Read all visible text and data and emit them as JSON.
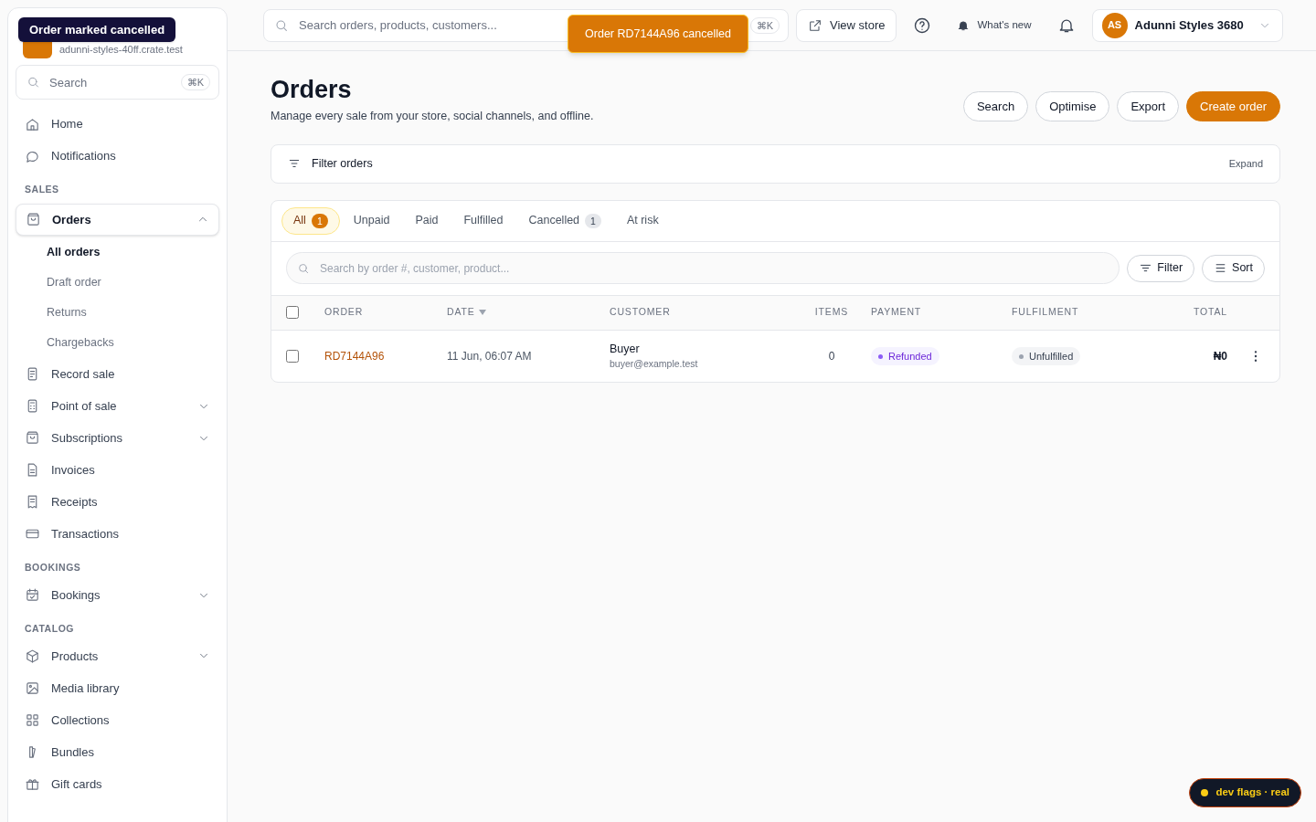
{
  "store": {
    "subtitle": "adunni-styles-40ff.crate.test"
  },
  "sidebar": {
    "search": {
      "placeholder": "Search",
      "shortcut": "⌘K"
    },
    "groups": [
      {
        "items": [
          {
            "label": "Home",
            "selected": false,
            "kind": "link"
          },
          {
            "label": "Notifications",
            "selected": false,
            "kind": "link"
          }
        ]
      },
      {
        "heading": "SALES",
        "items": [
          {
            "label": "Orders",
            "selected": true,
            "kind": "group",
            "expanded": true,
            "children": [
              {
                "label": "All orders",
                "selected": true
              },
              {
                "label": "Draft order",
                "selected": false
              },
              {
                "label": "Returns",
                "selected": false
              },
              {
                "label": "Chargebacks",
                "selected": false
              }
            ]
          },
          {
            "label": "Record sale",
            "selected": false,
            "kind": "link"
          },
          {
            "label": "Point of sale",
            "selected": false,
            "kind": "group",
            "expanded": false
          },
          {
            "label": "Subscriptions",
            "selected": false,
            "kind": "group",
            "expanded": false
          },
          {
            "label": "Invoices",
            "selected": false,
            "kind": "link"
          },
          {
            "label": "Receipts",
            "selected": false,
            "kind": "link"
          },
          {
            "label": "Transactions",
            "selected": false,
            "kind": "link"
          }
        ]
      },
      {
        "heading": "BOOKINGS",
        "items": [
          {
            "label": "Bookings",
            "selected": false,
            "kind": "group",
            "expanded": false
          }
        ]
      },
      {
        "heading": "CATALOG",
        "items": [
          {
            "label": "Products",
            "selected": false,
            "kind": "group",
            "expanded": false
          },
          {
            "label": "Media library",
            "selected": false,
            "kind": "link"
          },
          {
            "label": "Collections",
            "selected": false,
            "kind": "link"
          },
          {
            "label": "Bundles",
            "selected": false,
            "kind": "link"
          },
          {
            "label": "Gift cards",
            "selected": false,
            "kind": "link"
          }
        ]
      }
    ]
  },
  "topbar": {
    "search": {
      "placeholder": "Search orders, products, customers...",
      "shortcut": "⌘K"
    },
    "view_store": "View store",
    "whats_new": "What's new",
    "account": {
      "initials": "AS",
      "name": "Adunni Styles 3680"
    }
  },
  "page": {
    "title": "Orders",
    "subtitle": "Manage every sale from your store, social channels, and offline.",
    "actions": [
      {
        "label": "Search",
        "kind": "outline"
      },
      {
        "label": "Optimise",
        "kind": "outline"
      },
      {
        "label": "Export",
        "kind": "outline"
      },
      {
        "label": "Create order",
        "kind": "primary"
      }
    ],
    "filter_bar": {
      "label": "Filter orders",
      "expand": "Expand"
    }
  },
  "tabs": [
    {
      "label": "All",
      "count": "1",
      "selected": true
    },
    {
      "label": "Unpaid",
      "selected": false
    },
    {
      "label": "Paid",
      "selected": false
    },
    {
      "label": "Fulfilled",
      "selected": false
    },
    {
      "label": "Cancelled",
      "count": "1",
      "selected": false
    },
    {
      "label": "At risk",
      "selected": false
    }
  ],
  "table_search": {
    "placeholder": "Search by order #, customer, product..."
  },
  "table_buttons": [
    "Filter",
    "Sort"
  ],
  "table": {
    "select_all": {
      "checked": false
    },
    "columns": [
      {
        "label": "ORDER",
        "sorted": false
      },
      {
        "label": "DATE",
        "sorted": true
      },
      {
        "label": "CUSTOMER",
        "sorted": false
      },
      {
        "label": "ITEMS",
        "sorted": false
      },
      {
        "label": "PAYMENT",
        "sorted": false
      },
      {
        "label": "FULFILMENT",
        "sorted": false
      },
      {
        "label": "TOTAL",
        "sorted": false
      }
    ],
    "rows": [
      {
        "checked": false,
        "order": "RD7144A96",
        "date": "11 Jun, 06:07 AM",
        "customer": "Buyer",
        "email": "buyer@example.test",
        "items": "0",
        "payment": {
          "label": "Refunded",
          "color": "#8b5cf6"
        },
        "fulfilment": {
          "label": "Unfulfilled",
          "color": "#9ca3af"
        },
        "total": "₦0"
      }
    ]
  },
  "toasts": [
    {
      "text": "Order marked cancelled",
      "kind": "dark"
    },
    {
      "text": "Order RD7144A96 cancelled",
      "kind": "warning"
    }
  ],
  "dev_badge": {
    "text": "dev flags · real",
    "color": "#facc15"
  }
}
